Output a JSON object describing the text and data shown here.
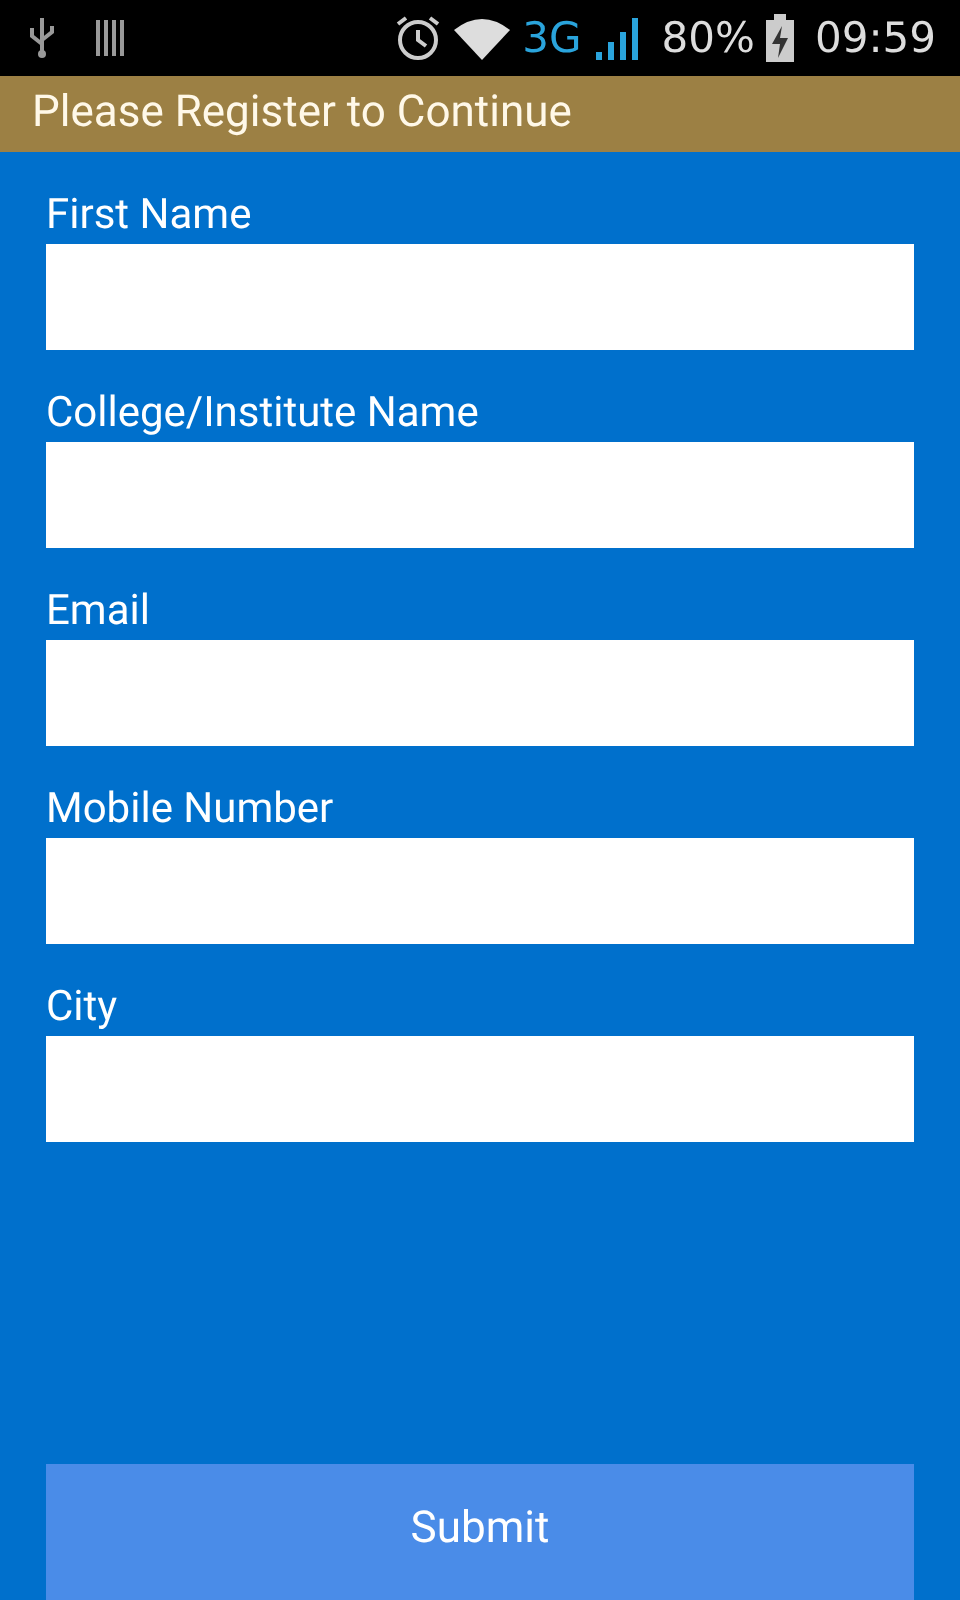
{
  "status_bar": {
    "network": "3G",
    "battery": "80%",
    "time": "09:59"
  },
  "title": "Please Register to Continue",
  "fields": [
    {
      "label": "First Name"
    },
    {
      "label": "College/Institute Name"
    },
    {
      "label": "Email"
    },
    {
      "label": "Mobile Number"
    },
    {
      "label": "City"
    }
  ],
  "submit": "Submit"
}
